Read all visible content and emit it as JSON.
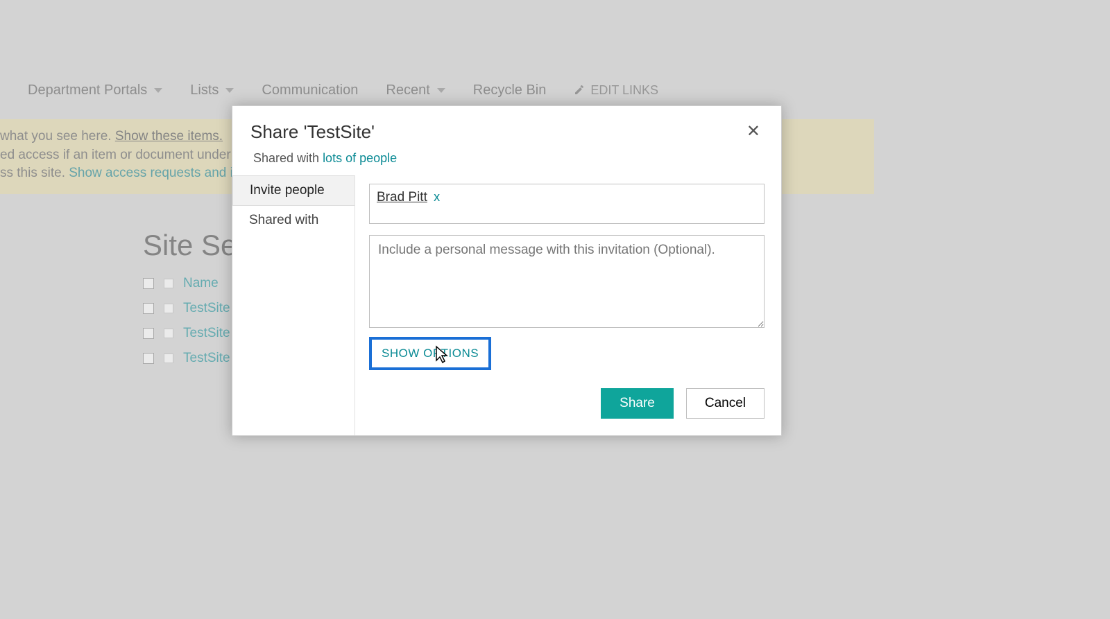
{
  "nav": {
    "items": [
      {
        "label": "Department Portals",
        "hasCaret": true
      },
      {
        "label": "Lists",
        "hasCaret": true
      },
      {
        "label": "Communication",
        "hasCaret": false
      },
      {
        "label": "Recent",
        "hasCaret": true
      },
      {
        "label": "Recycle Bin",
        "hasCaret": false
      }
    ],
    "editLinks": "EDIT LINKS"
  },
  "banner": {
    "line1_prefix": "what you see here. ",
    "line1_link": "Show these items.",
    "line2": "ed access if an item or document under the site",
    "line3_prefix": "ss this site. ",
    "line3_link": "Show access requests and invitation"
  },
  "page": {
    "title": "Site Sett",
    "nameColumn": "Name",
    "rows": [
      {
        "label": "TestSite"
      },
      {
        "label": "TestSite"
      },
      {
        "label": "TestSite"
      }
    ]
  },
  "dialog": {
    "title": "Share 'TestSite'",
    "sharedPrefix": "Shared with ",
    "sharedLink": "lots of people",
    "tabs": {
      "invite": "Invite people",
      "sharedWith": "Shared with"
    },
    "chip": {
      "name": "Brad Pitt",
      "remove": "x"
    },
    "messagePlaceholder": "Include a personal message with this invitation (Optional).",
    "showOptions": "SHOW OPTIONS",
    "shareBtn": "Share",
    "cancelBtn": "Cancel",
    "close": "✕"
  }
}
